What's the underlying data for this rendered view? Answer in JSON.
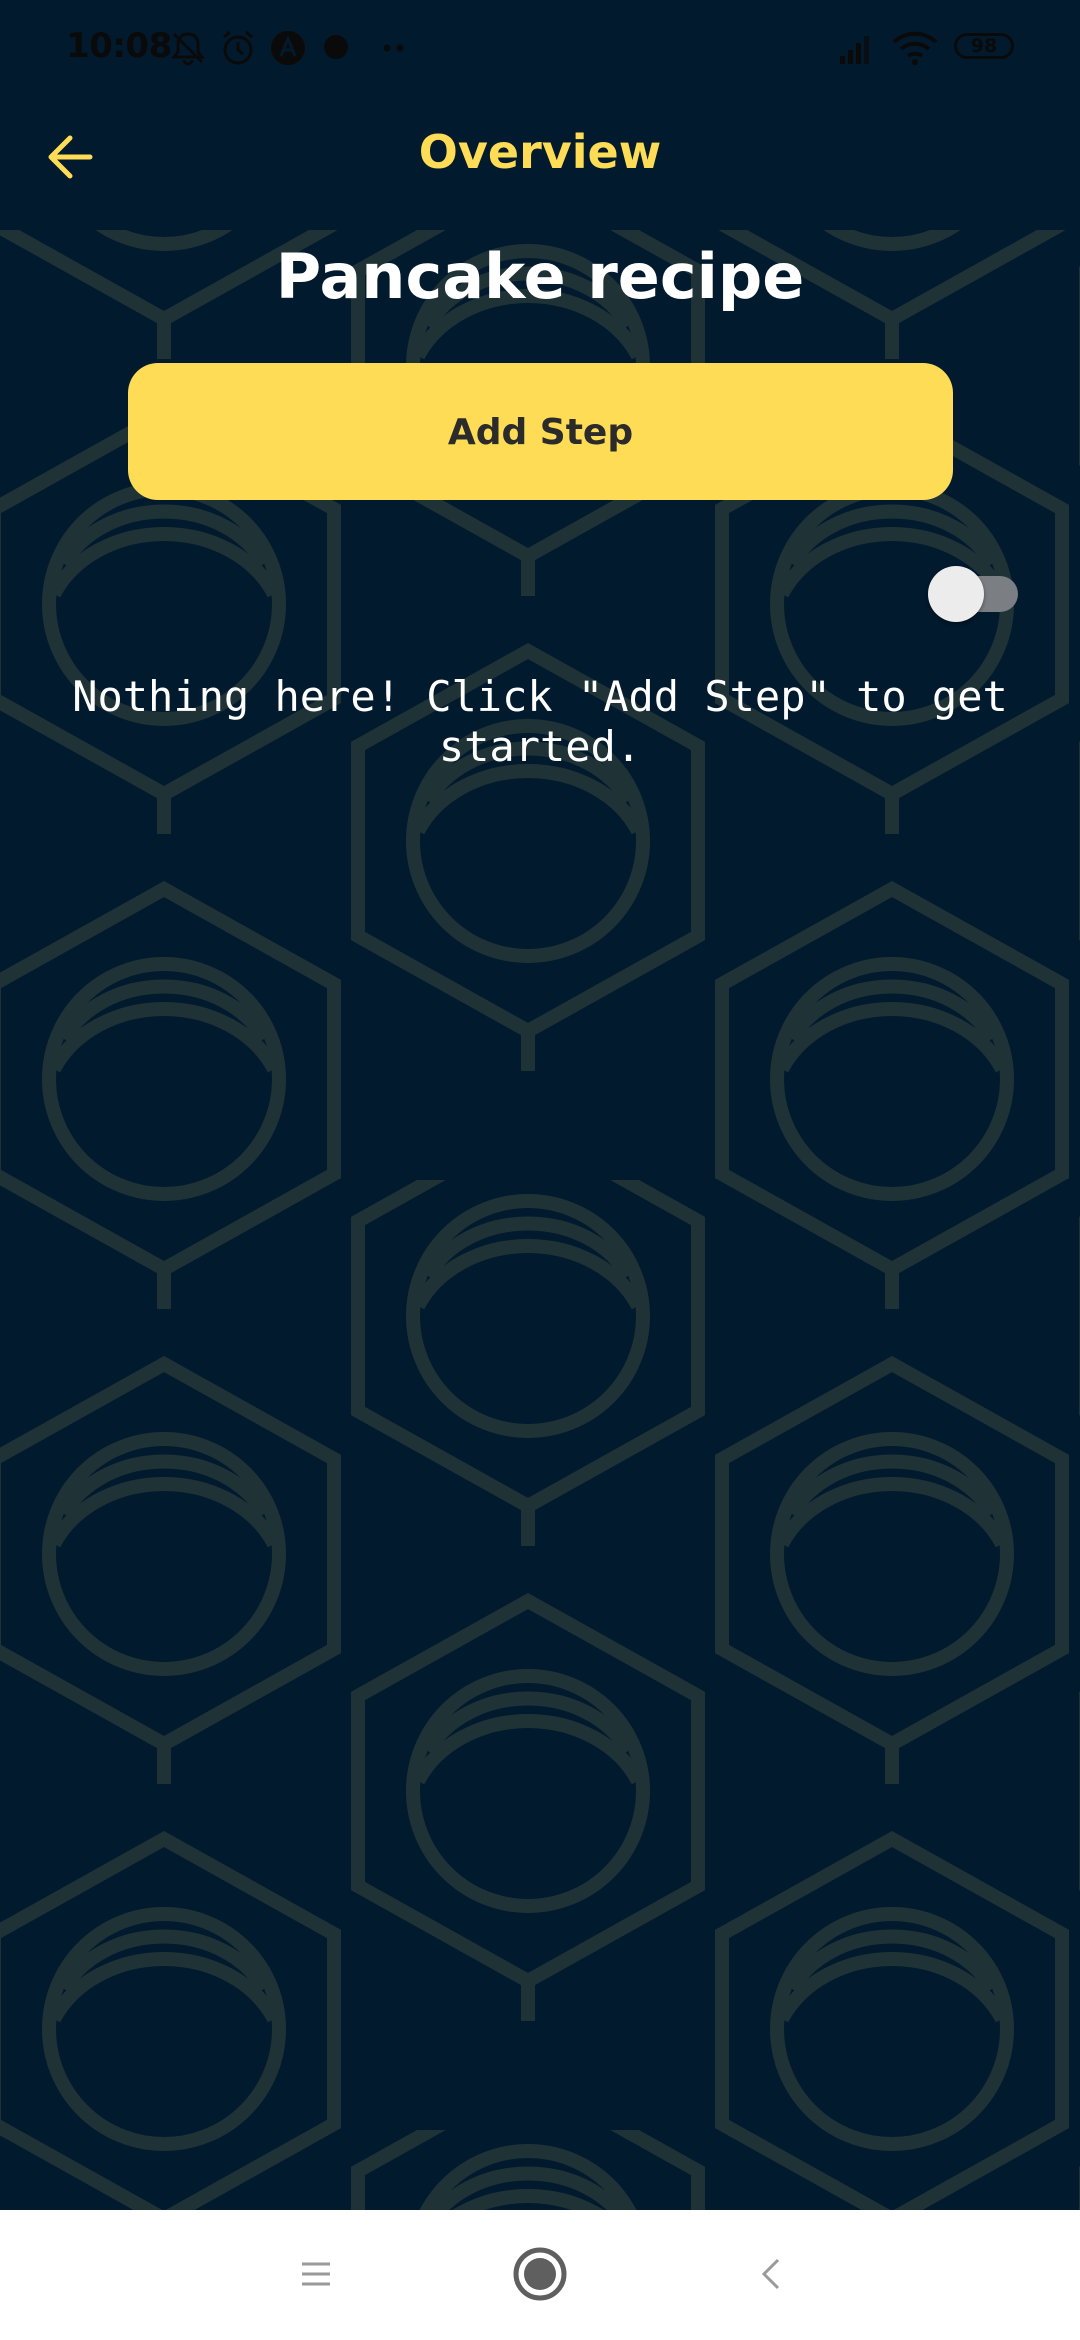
{
  "status_bar": {
    "time": "10:08",
    "battery": "98",
    "icons": [
      "notifications-off-icon",
      "alarm-icon",
      "app-a-icon",
      "record-dot-icon",
      "more-dots-icon",
      "signal-icon",
      "wifi-icon",
      "battery-icon"
    ]
  },
  "app_bar": {
    "title": "Overview",
    "back_icon": "arrow-left-icon"
  },
  "main": {
    "recipe_title": "Pancake recipe",
    "add_step_label": "Add Step",
    "toggle_on": false,
    "empty_message": "Nothing here! Click \"Add Step\" to get started."
  },
  "nav_bar": {
    "icons": [
      "menu-icon",
      "home-icon",
      "back-icon"
    ]
  },
  "colors": {
    "background": "#021a2e",
    "accent": "#fedc55",
    "pattern": "#1f3236",
    "text": "#ffffff"
  }
}
